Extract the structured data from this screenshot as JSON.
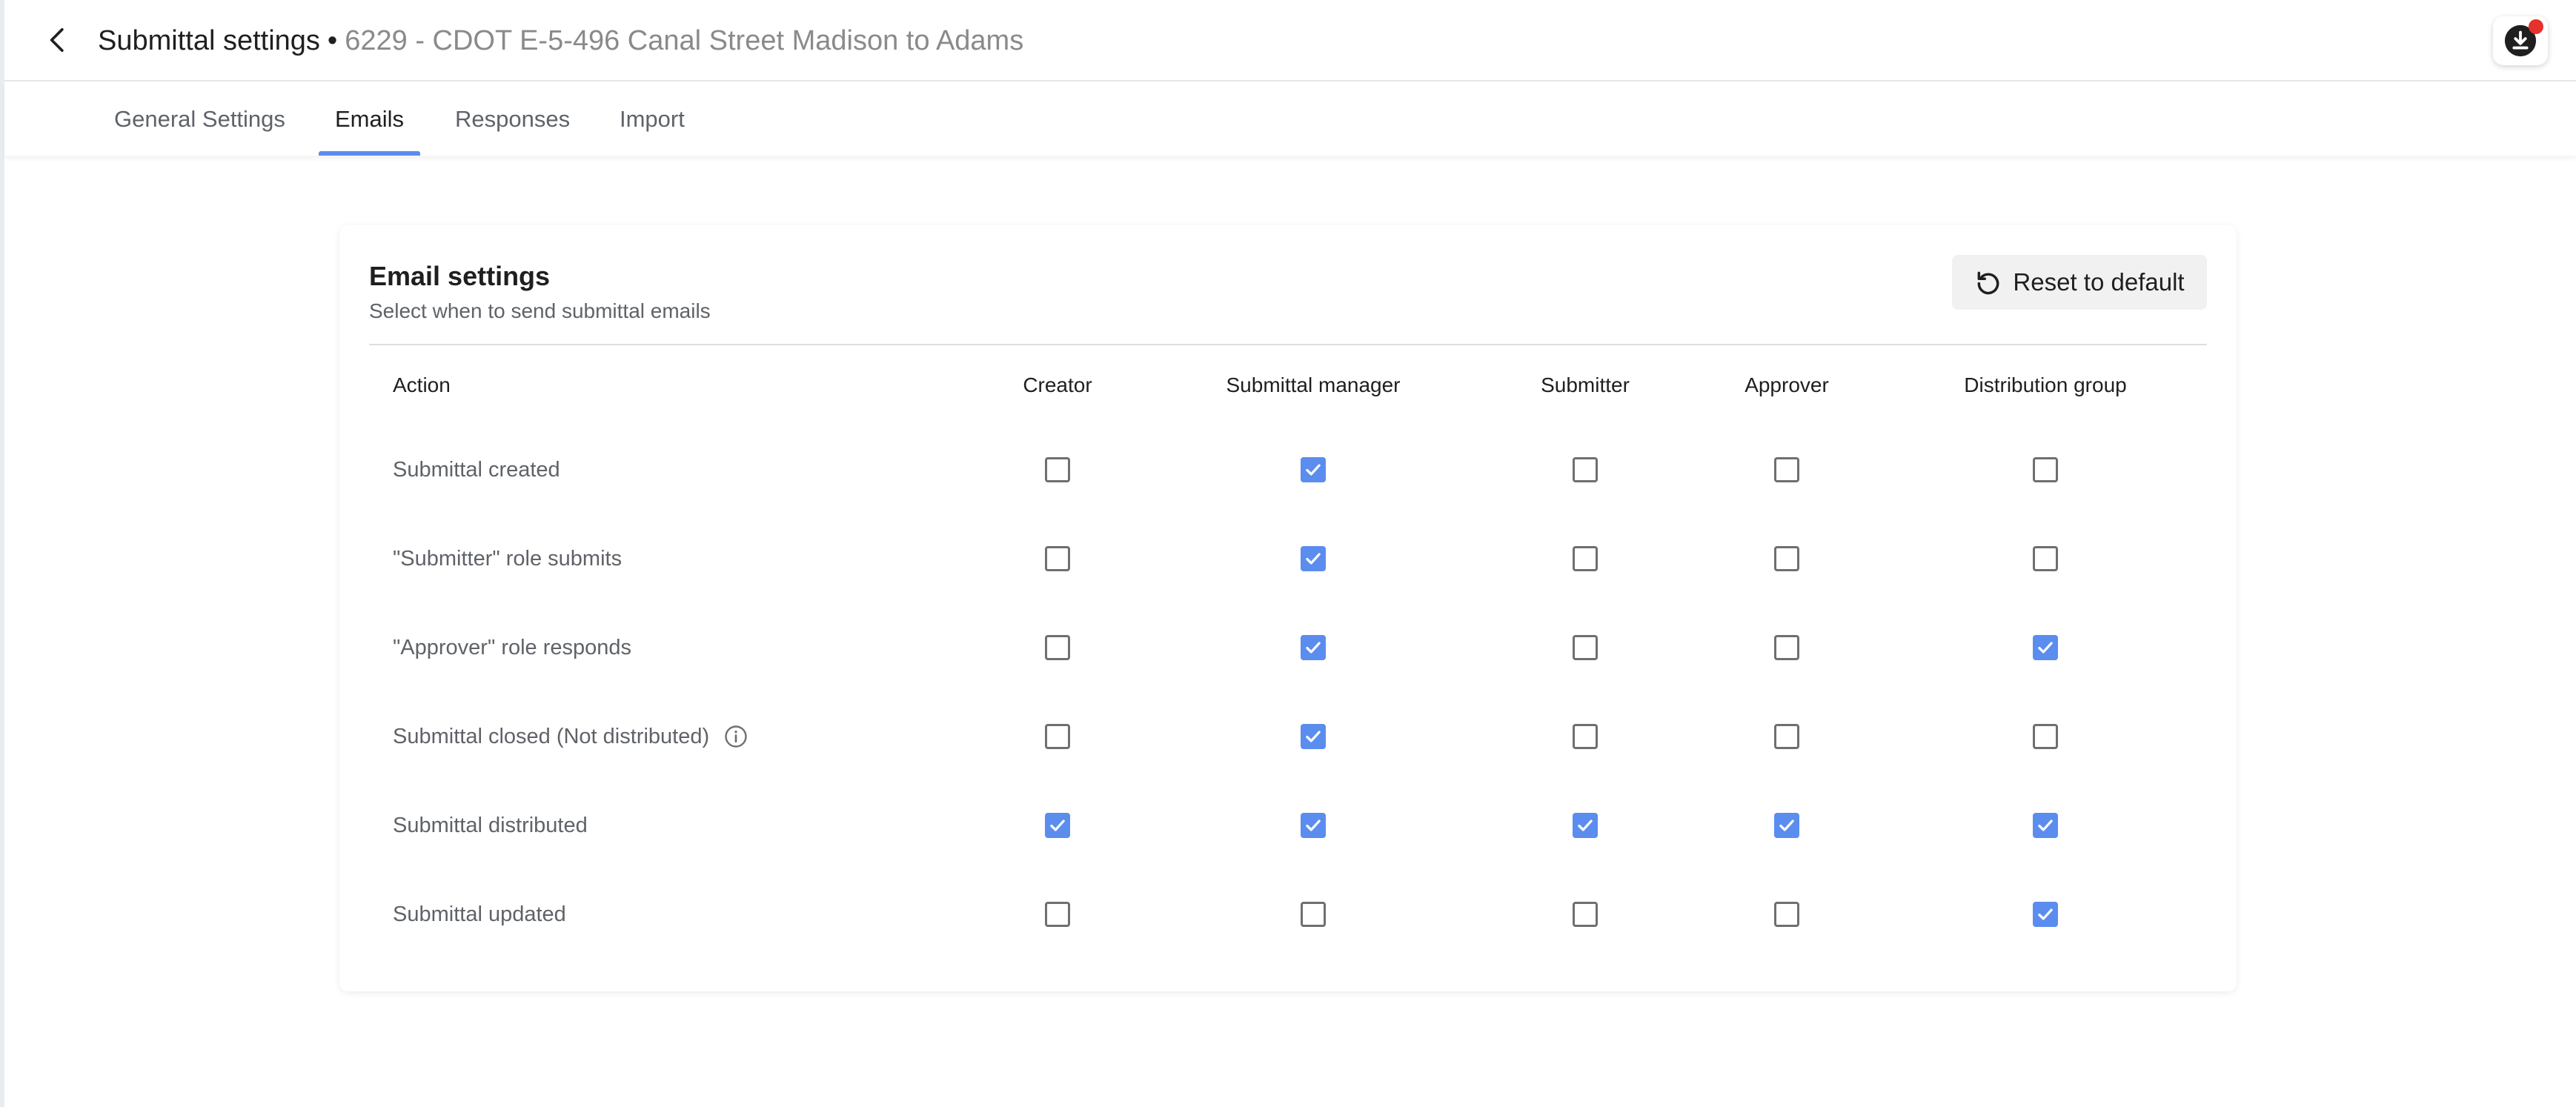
{
  "header": {
    "title": "Submittal settings",
    "separator": "•",
    "project": "6229 - CDOT E-5-496 Canal Street Madison to Adams",
    "back_icon": "chevron-left-icon",
    "download_icon": "download-icon"
  },
  "tabs": [
    {
      "label": "General Settings",
      "active": false
    },
    {
      "label": "Emails",
      "active": true
    },
    {
      "label": "Responses",
      "active": false
    },
    {
      "label": "Import",
      "active": false
    }
  ],
  "email_settings": {
    "title": "Email settings",
    "subtitle": "Select when to send submittal emails",
    "reset_label": "Reset to default",
    "reset_icon": "reset-icon",
    "columns": [
      "Action",
      "Creator",
      "Submittal manager",
      "Submitter",
      "Approver",
      "Distribution group"
    ],
    "rows": [
      {
        "action": "Submittal created",
        "info": false,
        "checks": [
          false,
          true,
          false,
          false,
          false
        ]
      },
      {
        "action": "\"Submitter\" role submits",
        "info": false,
        "checks": [
          false,
          true,
          false,
          false,
          false
        ]
      },
      {
        "action": "\"Approver\" role responds",
        "info": false,
        "checks": [
          false,
          true,
          false,
          false,
          true
        ]
      },
      {
        "action": "Submittal closed (Not distributed)",
        "info": true,
        "checks": [
          false,
          true,
          false,
          false,
          false
        ]
      },
      {
        "action": "Submittal distributed",
        "info": false,
        "checks": [
          true,
          true,
          true,
          true,
          true
        ]
      },
      {
        "action": "Submittal updated",
        "info": false,
        "checks": [
          false,
          false,
          false,
          false,
          true
        ]
      }
    ]
  },
  "colors": {
    "accent": "#5b8def",
    "notification": "#e5322d",
    "muted_text": "#5f6368",
    "project_text": "#8a8a8a"
  }
}
